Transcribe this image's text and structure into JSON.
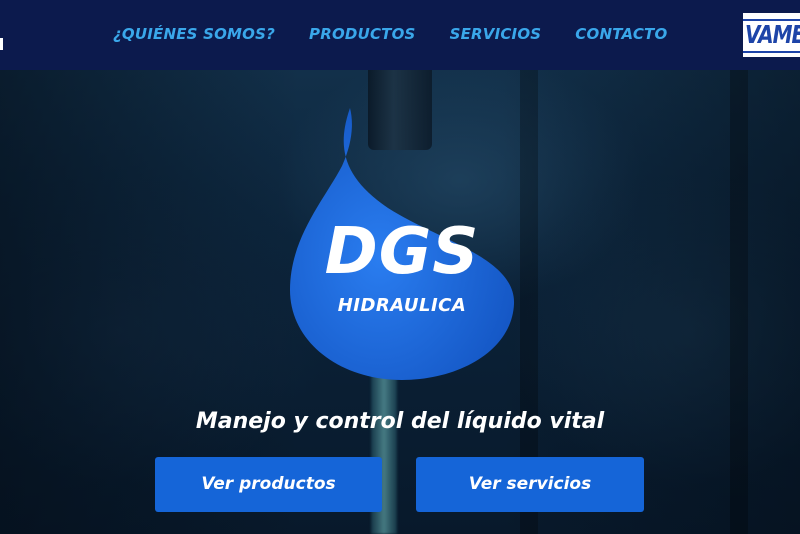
{
  "nav": {
    "items": [
      {
        "label": "¿QUIÉNES SOMOS?"
      },
      {
        "label": "PRODUCTOS"
      },
      {
        "label": "SERVICIOS"
      },
      {
        "label": "CONTACTO"
      }
    ],
    "brand_logo_text": "VAMEX"
  },
  "hero": {
    "logo": {
      "title": "DGS",
      "subtitle": "HIDRAULICA"
    },
    "tagline": "Manejo y control del líquido vital",
    "buttons": {
      "products_label": "Ver productos",
      "services_label": "Ver servicios"
    }
  },
  "colors": {
    "nav_background": "#0c1a4d",
    "nav_link": "#3aa7ea",
    "drop_blue": "#1b6be0",
    "button_blue": "#1565d8",
    "text_white": "#ffffff"
  }
}
